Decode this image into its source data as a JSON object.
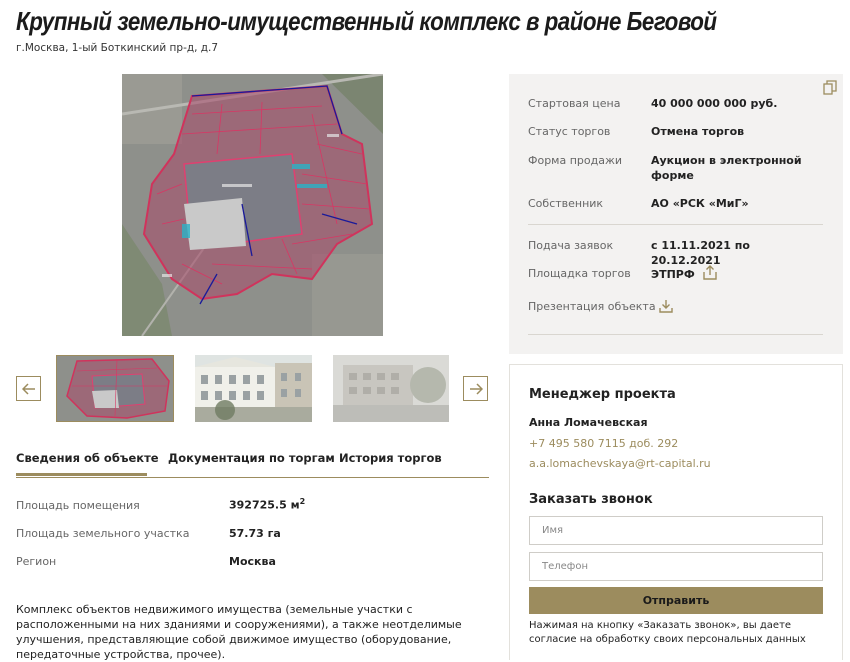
{
  "header": {
    "title": "Крупный земельно-имущественный комплекс в районе Беговой",
    "address": "г.Москва, 1-ый Боткинский пр-д, д.7"
  },
  "gallery": {
    "prev_icon": "arrow-left-icon",
    "next_icon": "arrow-right-icon"
  },
  "tabs": [
    {
      "label": "Сведения об объекте",
      "active": true
    },
    {
      "label": "Документация по торгам",
      "active": false
    },
    {
      "label": "История торгов",
      "active": false
    }
  ],
  "properties": [
    {
      "label": "Площадь помещения",
      "value": "392725.5 м",
      "sup": "2"
    },
    {
      "label": "Площадь земельного участка",
      "value": "57.73 га"
    },
    {
      "label": "Регион",
      "value": "Москва"
    }
  ],
  "description": "Комплекс объектов недвижимого имущества (земельные участки с расположенными на них зданиями и сооружениями), а также неотделимые улучшения, представляющие собой движимое имущество (оборудование, передаточные устройства, прочее).",
  "auction": {
    "copy_icon": "copy-icon",
    "rows": [
      {
        "label": "Стартовая цена",
        "value": "40 000 000 000 руб."
      },
      {
        "label": "Статус торгов",
        "value": "Отмена торгов"
      },
      {
        "label": "Форма продажи",
        "value": "Аукцион в электронной форме"
      },
      {
        "label": "Собственник",
        "value": "АО «РСК «МиГ»"
      },
      {
        "label": "Подача заявок",
        "value": "с 11.11.2021 по 20.12.2021"
      },
      {
        "label": "Площадка торгов",
        "value": "ЭТПРФ",
        "icon": "external-link-icon"
      }
    ],
    "presentation_label": "Презентация объекта",
    "presentation_icon": "download-icon"
  },
  "manager": {
    "heading": "Менеджер проекта",
    "name": "Анна Ломачевская",
    "phone": "+7 495 580 7115 доб. 292",
    "email": "a.a.lomachevskaya@rt-capital.ru"
  },
  "callback": {
    "heading": "Заказать звонок",
    "name_placeholder": "Имя",
    "phone_placeholder": "Телефон",
    "submit_label": "Отправить",
    "consent": "Нажимая на кнопку «Заказать звонок», вы даете согласие на обработку своих персональных данных"
  },
  "colors": {
    "accent": "#9c8c5e",
    "panel": "#f3f2f1",
    "text": "#222222",
    "muted": "#666666"
  }
}
